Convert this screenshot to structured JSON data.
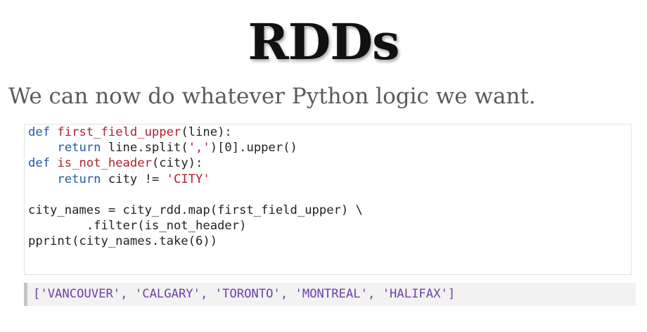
{
  "slide": {
    "title": "RDDs",
    "subtitle": "We can now do whatever Python logic we want."
  },
  "code": {
    "line1": {
      "kw": "def",
      "sp": " ",
      "name": "first_field_upper",
      "rest": "(line):"
    },
    "line2": {
      "indent": "    ",
      "kw": "return",
      "rest1": " line.split(",
      "str": "','",
      "rest2": ")[0].upper()"
    },
    "line3": {
      "kw": "def",
      "sp": " ",
      "name": "is_not_header",
      "rest": "(city):"
    },
    "line4": {
      "indent": "    ",
      "kw": "return",
      "rest1": " city != ",
      "str": "'CITY'"
    },
    "line5": "",
    "line6": "city_names = city_rdd.map(first_field_upper) \\",
    "line7": "        .filter(is_not_header)",
    "line8": "pprint(city_names.take(6))"
  },
  "output": {
    "text": "['VANCOUVER', 'CALGARY', 'TORONTO', 'MONTREAL', 'HALIFAX']"
  },
  "colors": {
    "keyword": "#1f5aa6",
    "function_name": "#b2202e",
    "string": "#b2202e",
    "output_text": "#6f42a8",
    "output_bar": "#c4c4c4"
  }
}
